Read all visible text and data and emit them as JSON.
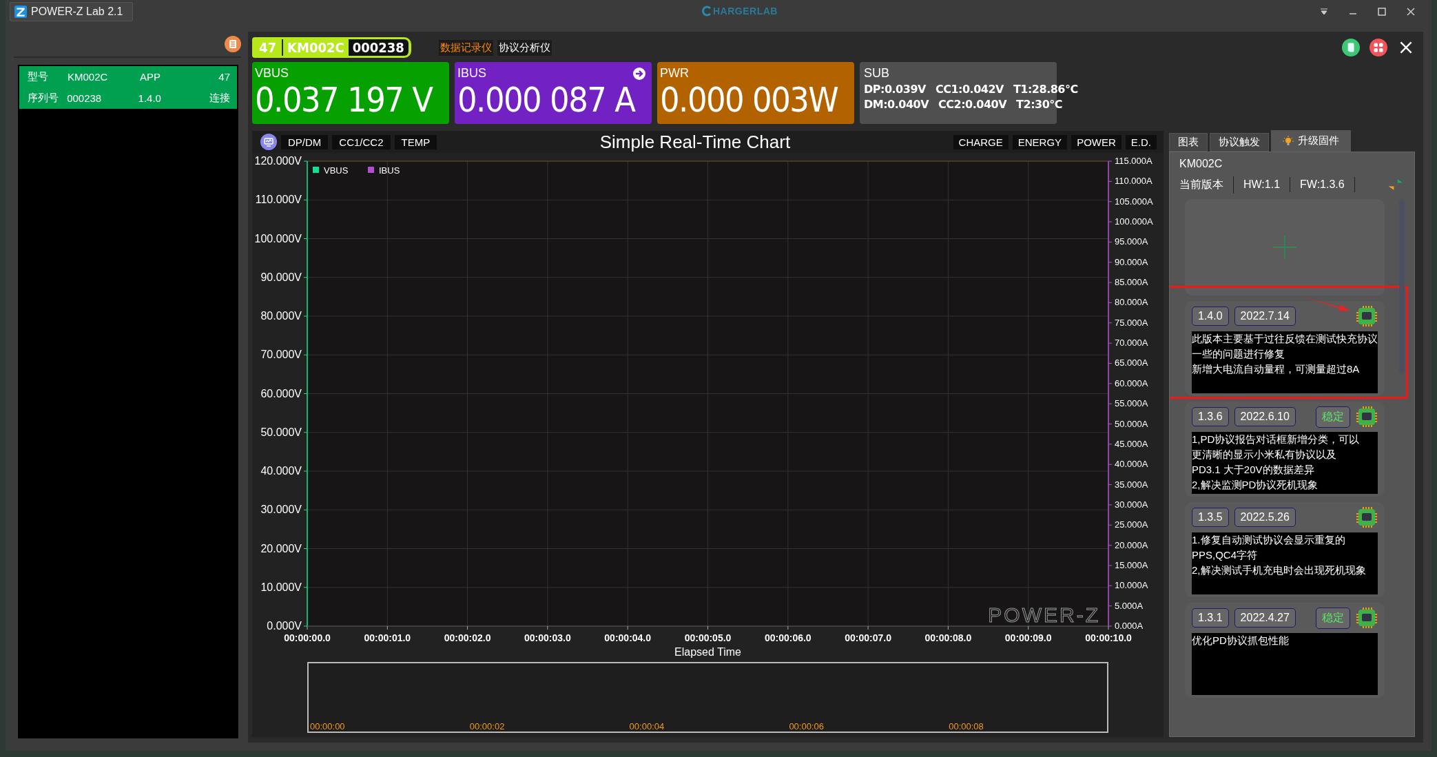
{
  "window": {
    "title": "POWER-Z Lab 2.1",
    "logo_text": "HARGERLAB"
  },
  "device_list": {
    "rows": [
      {
        "cells": [
          "型号",
          "KM002C",
          "APP",
          "47"
        ],
        "selected": true
      },
      {
        "cells": [
          "序列号",
          "000238",
          "1.4.0",
          "连接"
        ],
        "selected": true
      }
    ]
  },
  "device_badge": {
    "port": "47",
    "model": "KM002C",
    "serial": "000238"
  },
  "mode_tabs": [
    {
      "label": "数据记录仪",
      "selected": true
    },
    {
      "label": "协议分析仪",
      "selected": false
    }
  ],
  "readings": [
    {
      "kind": "big",
      "label": "VBUS",
      "value": "0.037 197 V",
      "color": "#06a000",
      "has_arrow": false
    },
    {
      "kind": "big",
      "label": "IBUS",
      "value": "0.000 087 A",
      "color": "#7222c2",
      "has_arrow": true
    },
    {
      "kind": "big",
      "label": "PWR",
      "value": "0.000 003W",
      "color": "#b36200",
      "has_arrow": false
    },
    {
      "kind": "sub",
      "label": "SUB",
      "lines": [
        [
          "DP:0.039V",
          "CC1:0.042V",
          "T1:28.86°C"
        ],
        [
          "DM:0.040V",
          "CC2:0.040V",
          "T2:30°C"
        ]
      ],
      "color": "#4f4f4f"
    }
  ],
  "chart": {
    "left_buttons": [
      "DP/DM",
      "CC1/CC2",
      "TEMP"
    ],
    "right_buttons": [
      "CHARGE",
      "ENERGY",
      "POWER",
      "E.D."
    ],
    "logo_text": "POWER-Z",
    "chart_data": {
      "type": "line",
      "title": "Simple Real-Time Chart",
      "xlabel": "Elapsed Time",
      "categories": [
        "00:00:00.0",
        "00:00:01.0",
        "00:00:02.0",
        "00:00:03.0",
        "00:00:04.0",
        "00:00:05.0",
        "00:00:06.0",
        "00:00:07.0",
        "00:00:08.0",
        "00:00:09.0",
        "00:00:10.0"
      ],
      "grid": true,
      "series": [
        {
          "name": "VBUS",
          "color": "#10e090",
          "values": [
            null,
            null,
            null,
            null,
            null,
            null,
            null,
            null,
            null,
            null,
            null
          ]
        },
        {
          "name": "IBUS",
          "color": "#b24fd0",
          "values": [
            null,
            null,
            null,
            null,
            null,
            null,
            null,
            null,
            null,
            null,
            null
          ]
        }
      ],
      "ylim": [
        0,
        120
      ],
      "yticks": [
        {
          "value": 0,
          "label": "0.000V"
        },
        {
          "value": 10,
          "label": "10.000V"
        },
        {
          "value": 20,
          "label": "20.000V"
        },
        {
          "value": 30,
          "label": "30.000V"
        },
        {
          "value": 40,
          "label": "40.000V"
        },
        {
          "value": 50,
          "label": "50.000V"
        },
        {
          "value": 60,
          "label": "60.000V"
        },
        {
          "value": 70,
          "label": "70.000V"
        },
        {
          "value": 80,
          "label": "80.000V"
        },
        {
          "value": 90,
          "label": "90.000V"
        },
        {
          "value": 100,
          "label": "100.000V"
        },
        {
          "value": 110,
          "label": "110.000V"
        },
        {
          "value": 120,
          "label": "120.000V"
        }
      ],
      "y2lim": [
        0,
        115
      ],
      "y2ticks": [
        {
          "value": 0,
          "label": "0.000A"
        },
        {
          "value": 5,
          "label": "5.000A"
        },
        {
          "value": 10,
          "label": "10.000A"
        },
        {
          "value": 15,
          "label": "15.000A"
        },
        {
          "value": 20,
          "label": "20.000A"
        },
        {
          "value": 25,
          "label": "25.000A"
        },
        {
          "value": 30,
          "label": "30.000A"
        },
        {
          "value": 35,
          "label": "35.000A"
        },
        {
          "value": 40,
          "label": "40.000A"
        },
        {
          "value": 45,
          "label": "45.000A"
        },
        {
          "value": 50,
          "label": "50.000A"
        },
        {
          "value": 55,
          "label": "55.000A"
        },
        {
          "value": 60,
          "label": "60.000A"
        },
        {
          "value": 65,
          "label": "65.000A"
        },
        {
          "value": 70,
          "label": "70.000A"
        },
        {
          "value": 75,
          "label": "75.000A"
        },
        {
          "value": 80,
          "label": "80.000A"
        },
        {
          "value": 85,
          "label": "85.000A"
        },
        {
          "value": 90,
          "label": "90.000A"
        },
        {
          "value": 95,
          "label": "95.000A"
        },
        {
          "value": 100,
          "label": "100.000A"
        },
        {
          "value": 105,
          "label": "105.000A"
        },
        {
          "value": 110,
          "label": "110.000A"
        },
        {
          "value": 115,
          "label": "115.000A"
        }
      ]
    },
    "overview_labels": [
      "00:00:00",
      "00:00:02",
      "00:00:04",
      "00:00:06",
      "00:00:08"
    ]
  },
  "side_tabs": [
    {
      "label": "图表",
      "selected": false
    },
    {
      "label": "协议触发",
      "selected": false
    },
    {
      "label": "升级固件",
      "selected": true
    }
  ],
  "firmware": {
    "model": "KM002C",
    "current_label": "当前版本",
    "hw": "HW:1.1",
    "fw": "FW:1.3.6",
    "releases": [
      {
        "version": "1.4.0",
        "date": "2022.7.14",
        "stable": false,
        "highlighted": true,
        "notes": [
          "此版本主要基于过往反馈在测试快充协议一些的问题进行修复",
          "新增大电流自动量程，可测量超过8A"
        ]
      },
      {
        "version": "1.3.6",
        "date": "2022.6.10",
        "stable": true,
        "stable_label": "稳定",
        "highlighted": false,
        "notes": [
          "1,PD协议报告对话框新增分类，可以",
          "更清晰的显示小米私有协议以及",
          "PD3.1 大于20V的数据差异",
          "2,解决监测PD协议死机现象"
        ]
      },
      {
        "version": "1.3.5",
        "date": "2022.5.26",
        "stable": false,
        "highlighted": false,
        "notes": [
          "1.修复自动测试协议会显示重复的",
          "PPS,QC4字符",
          "2,解决测试手机充电时会出现死机现象"
        ]
      },
      {
        "version": "1.3.1",
        "date": "2022.4.27",
        "stable": true,
        "stable_label": "稳定",
        "highlighted": false,
        "notes": [
          "优化PD协议抓包性能"
        ]
      }
    ]
  }
}
